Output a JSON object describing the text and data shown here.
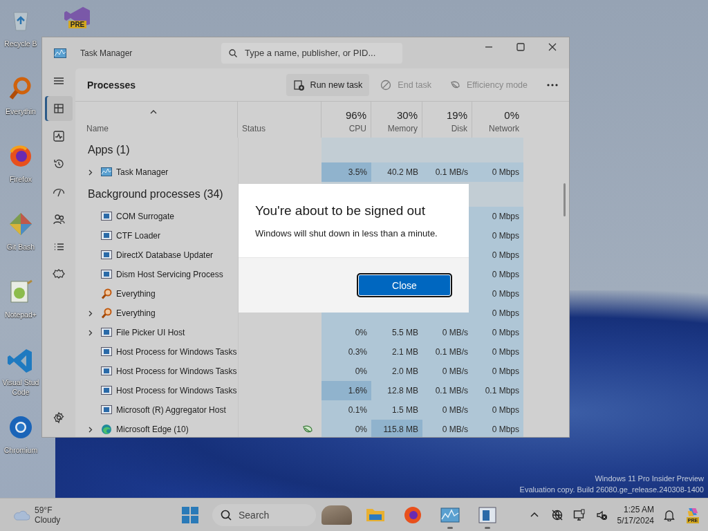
{
  "desktop": {
    "icons": [
      {
        "kind": "recycle",
        "label": "Recycle B"
      },
      {
        "kind": "everything",
        "label": "Everythin"
      },
      {
        "kind": "firefox",
        "label": "Firefox"
      },
      {
        "kind": "git",
        "label": "Git Bash"
      },
      {
        "kind": "notepad",
        "label": "Notepad+"
      },
      {
        "kind": "vscode",
        "label": "Visual Stud\nCode"
      },
      {
        "kind": "chromium",
        "label": "Chromium"
      }
    ],
    "preview_icon": {
      "badge": "PRE"
    },
    "watermark": [
      "Windows 11 Pro Insider Preview",
      "Evaluation copy. Build 26080.ge_release.240308-1400"
    ]
  },
  "window": {
    "title": "Task Manager",
    "search": {
      "placeholder": "Type a name, publisher, or PID..."
    },
    "nav": [
      {
        "kind": "menu",
        "selected": false
      },
      {
        "kind": "processes",
        "selected": true
      },
      {
        "kind": "performance",
        "selected": false
      },
      {
        "kind": "history",
        "selected": false
      },
      {
        "kind": "startup",
        "selected": false
      },
      {
        "kind": "users",
        "selected": false
      },
      {
        "kind": "details",
        "selected": false
      },
      {
        "kind": "services",
        "selected": false
      },
      {
        "kind": "settings",
        "selected": false
      }
    ],
    "page_title": "Processes",
    "toolbar": [
      {
        "kind": "run",
        "label": "Run new task",
        "disabled": false
      },
      {
        "kind": "end",
        "label": "End task",
        "disabled": true
      },
      {
        "kind": "efficiency",
        "label": "Efficiency mode",
        "disabled": true
      }
    ],
    "columns": [
      {
        "label": "Name"
      },
      {
        "label": "Status"
      },
      {
        "percent": "96%",
        "label": "CPU"
      },
      {
        "percent": "30%",
        "label": "Memory"
      },
      {
        "percent": "19%",
        "label": "Disk"
      },
      {
        "percent": "0%",
        "label": "Network"
      }
    ],
    "groups": [
      {
        "title": "Apps (1)",
        "rows": [
          {
            "kind": "taskmanager",
            "name": "Task Manager",
            "expandable": true,
            "cpu": "3.5%",
            "memory": "40.2 MB",
            "disk": "0.1 MB/s",
            "network": "0 Mbps",
            "cpu_high": true,
            "memory_high": false
          }
        ]
      },
      {
        "title": "Background processes (34)",
        "rows": [
          {
            "kind": "app",
            "name": "COM Surrogate",
            "expandable": false,
            "network": "0 Mbps",
            "cpu_high": false,
            "memory_high": false
          },
          {
            "kind": "app",
            "name": "CTF Loader",
            "expandable": false,
            "network": "0 Mbps",
            "cpu_high": false,
            "memory_high": false
          },
          {
            "kind": "app",
            "name": "DirectX Database Updater",
            "expandable": false,
            "network": "0 Mbps",
            "cpu_high": false,
            "memory_high": false
          },
          {
            "kind": "app",
            "name": "Dism Host Servicing Process",
            "expandable": false,
            "network": "0 Mbps",
            "cpu_high": false,
            "memory_high": false
          },
          {
            "kind": "everything",
            "name": "Everything",
            "expandable": false,
            "network": "0 Mbps",
            "cpu_high": false,
            "memory_high": false
          },
          {
            "kind": "everything",
            "name": "Everything",
            "expandable": true,
            "network": "0 Mbps",
            "cpu_high": false,
            "memory_high": false
          },
          {
            "kind": "app",
            "name": "File Picker UI Host",
            "expandable": true,
            "cpu": "0%",
            "memory": "5.5 MB",
            "disk": "0 MB/s",
            "network": "0 Mbps",
            "cpu_high": false,
            "memory_high": false
          },
          {
            "kind": "app",
            "name": "Host Process for Windows Tasks",
            "expandable": false,
            "cpu": "0.3%",
            "memory": "2.1 MB",
            "disk": "0.1 MB/s",
            "network": "0 Mbps",
            "cpu_high": false,
            "memory_high": false
          },
          {
            "kind": "app",
            "name": "Host Process for Windows Tasks",
            "expandable": false,
            "cpu": "0%",
            "memory": "2.0 MB",
            "disk": "0 MB/s",
            "network": "0 Mbps",
            "cpu_high": false,
            "memory_high": false
          },
          {
            "kind": "app",
            "name": "Host Process for Windows Tasks",
            "expandable": false,
            "cpu": "1.6%",
            "memory": "12.8 MB",
            "disk": "0.1 MB/s",
            "network": "0.1 Mbps",
            "cpu_high": true,
            "memory_high": false
          },
          {
            "kind": "app",
            "name": "Microsoft (R) Aggregator Host",
            "expandable": false,
            "cpu": "0.1%",
            "memory": "1.5 MB",
            "disk": "0 MB/s",
            "network": "0 Mbps",
            "cpu_high": false,
            "memory_high": false
          },
          {
            "kind": "edge",
            "name": "Microsoft Edge (10)",
            "expandable": true,
            "efficiency_mode": true,
            "cpu": "0%",
            "memory": "115.8 MB",
            "disk": "0 MB/s",
            "network": "0 Mbps",
            "cpu_high": false,
            "memory_high": true
          }
        ]
      }
    ]
  },
  "dialog": {
    "title": "You're about to be signed out",
    "message": "Windows will shut down in less than a minute.",
    "button": "Close"
  },
  "taskbar": {
    "weather": {
      "temperature": "59°F",
      "condition": "Cloudy"
    },
    "search": {
      "placeholder": "Search"
    },
    "apps": [
      {
        "kind": "explorer",
        "running": false
      },
      {
        "kind": "firefox",
        "running": false
      },
      {
        "kind": "taskmanager",
        "running": true
      },
      {
        "kind": "window",
        "running": true
      }
    ],
    "tray": [
      {
        "kind": "chevron"
      },
      {
        "kind": "network"
      },
      {
        "kind": "monitor"
      },
      {
        "kind": "sound"
      }
    ],
    "time": "1:25 AM",
    "date": "5/17/2024",
    "copilot_badge": "PRE"
  }
}
